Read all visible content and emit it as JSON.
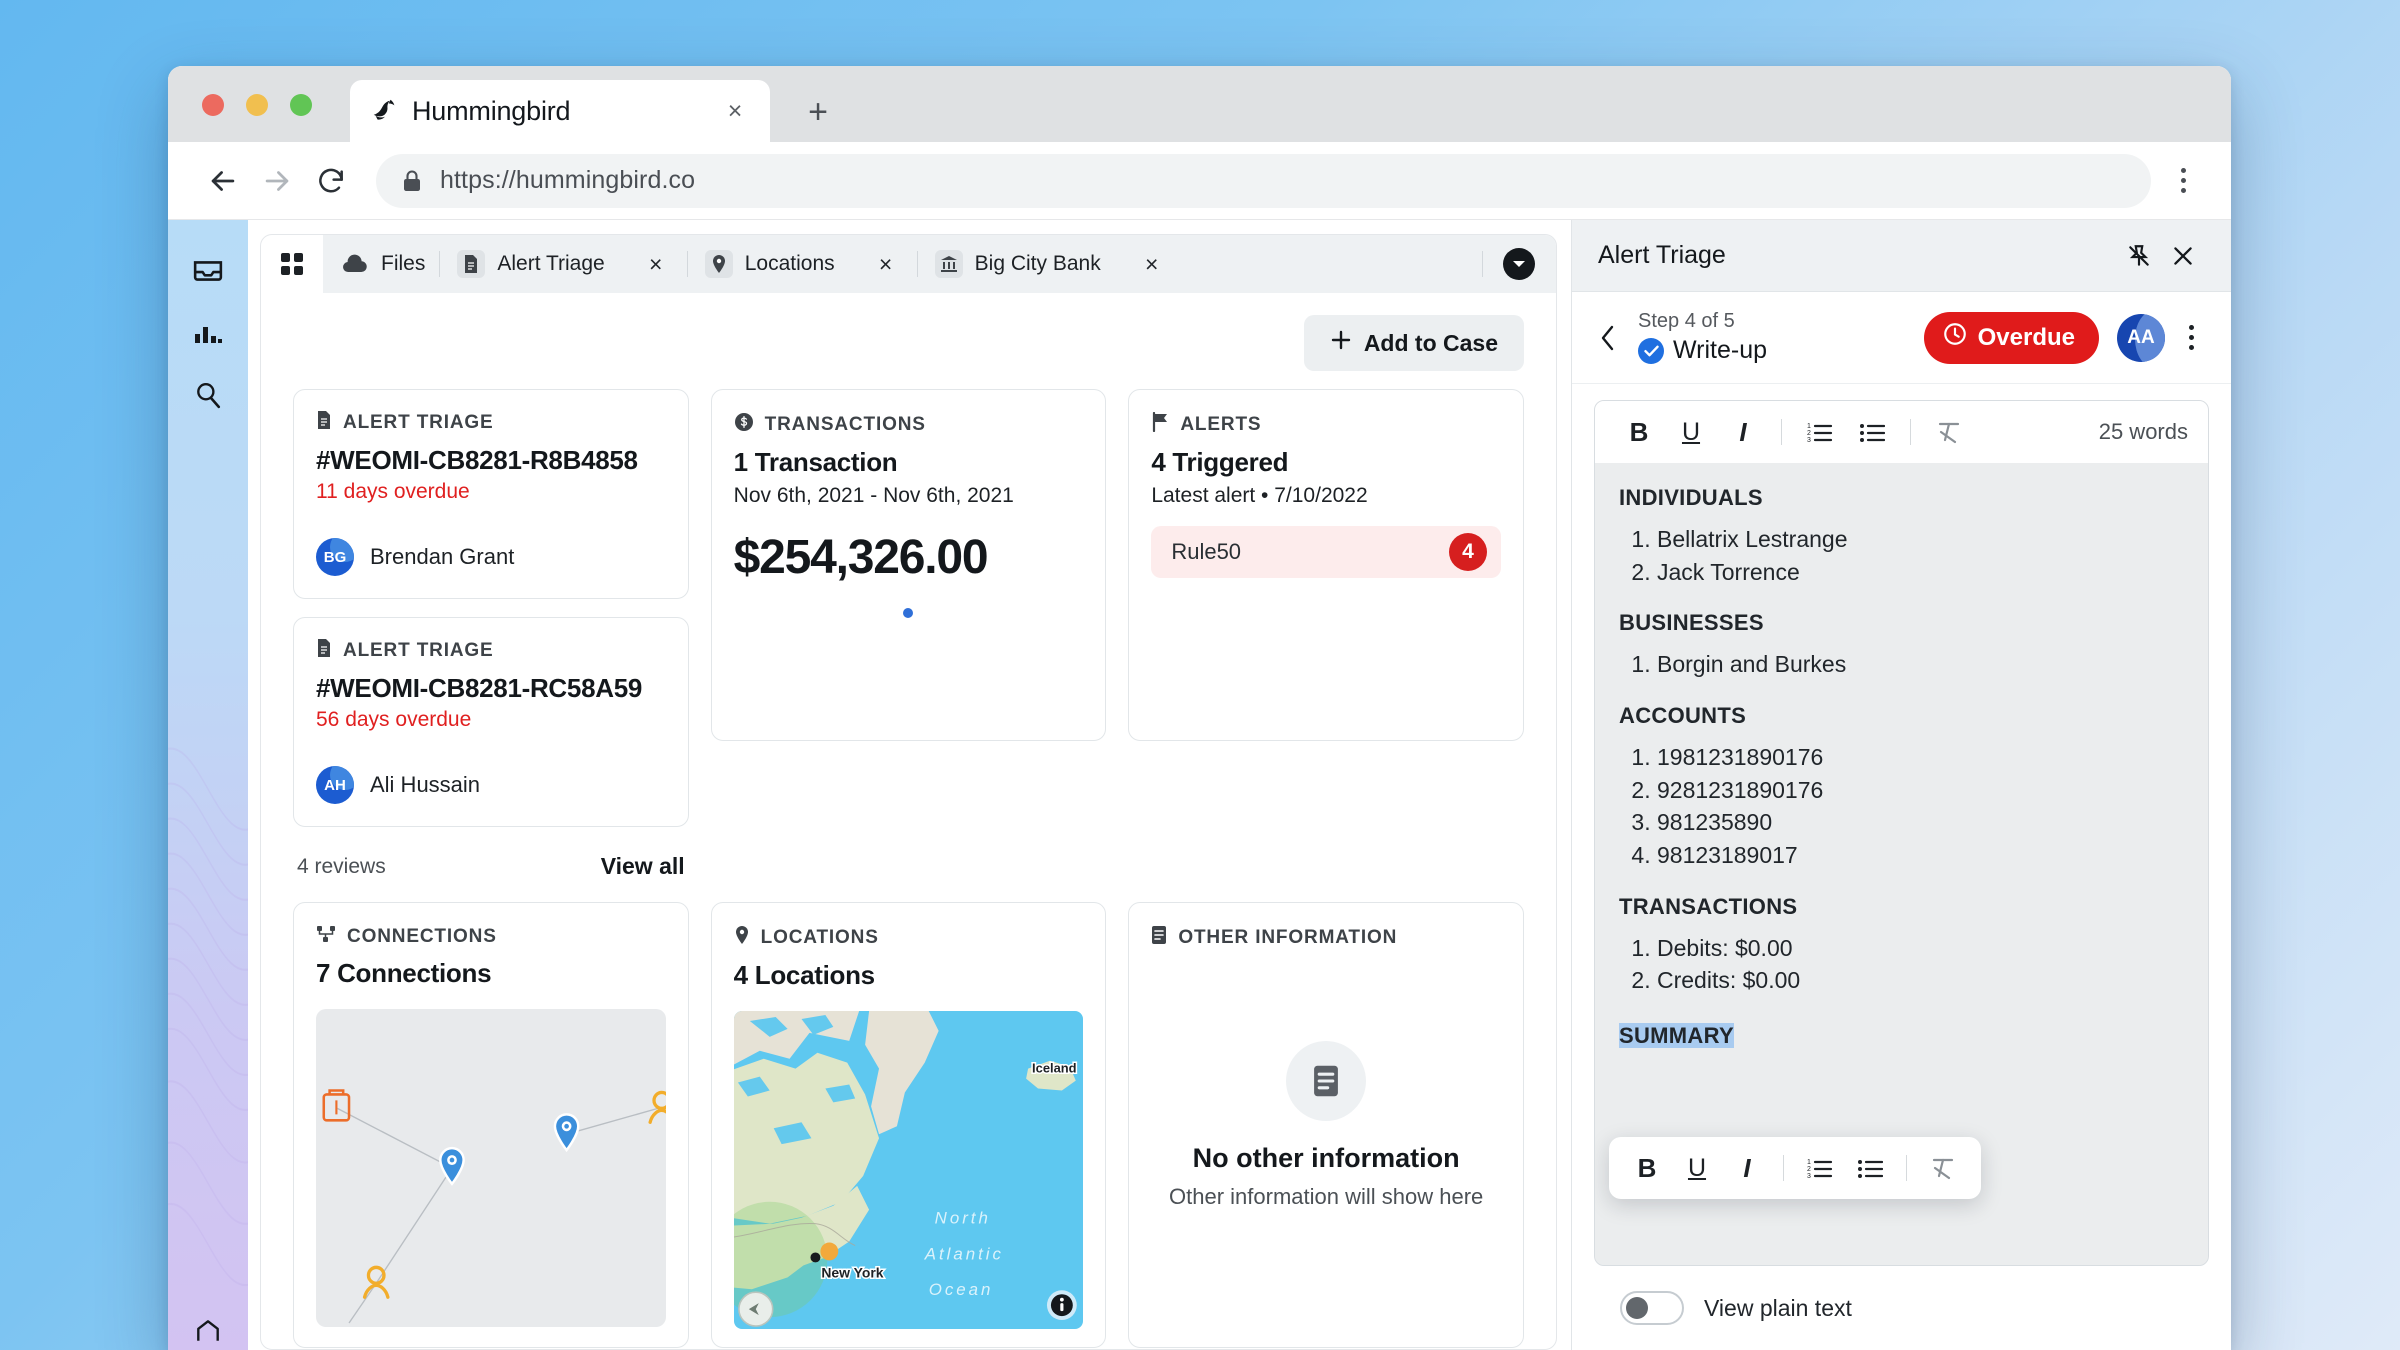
{
  "browser": {
    "tab_title": "Hummingbird",
    "tab_favicon": "hummingbird-logo-icon",
    "url": "https://hummingbird.co",
    "new_tab_label": "+",
    "close_tab_label": "×"
  },
  "rail": {
    "items": [
      {
        "name": "inbox-icon"
      },
      {
        "name": "analytics-icon"
      },
      {
        "name": "search-icon"
      }
    ]
  },
  "app_tabs": {
    "grid_icon": "grid-icon",
    "more_icon": "chevron-down-icon",
    "items": [
      {
        "label": "Files",
        "icon": "cloud-icon",
        "closable": false,
        "chip": false
      },
      {
        "label": "Alert Triage",
        "icon": "document-icon",
        "closable": true,
        "chip": true
      },
      {
        "label": "Locations",
        "icon": "map-pin-icon",
        "closable": true,
        "chip": true
      },
      {
        "label": "Big City Bank",
        "icon": "bank-icon",
        "closable": true,
        "chip": true
      }
    ],
    "close_label": "×"
  },
  "toolbar": {
    "add_to_case": "Add to Case",
    "add_icon": "plus-icon"
  },
  "cards": {
    "alert_triage": [
      {
        "kicker": "ALERT TRIAGE",
        "icon": "document-icon",
        "id": "#WEOMI-CB8281-R8B4858",
        "overdue": "11 days overdue",
        "assignee": "Brendan Grant",
        "initials": "BG"
      },
      {
        "kicker": "ALERT TRIAGE",
        "icon": "document-icon",
        "id": "#WEOMI-CB8281-RC58A59",
        "overdue": "56 days overdue",
        "assignee": "Ali Hussain",
        "initials": "AH"
      }
    ],
    "reviews": {
      "count_label": "4 reviews",
      "view_all": "View all"
    },
    "transactions": {
      "kicker": "TRANSACTIONS",
      "icon": "dollar-circle-icon",
      "title": "1 Transaction",
      "date_range": "Nov 6th, 2021 - Nov 6th, 2021",
      "amount": "$254,326.00"
    },
    "alerts": {
      "kicker": "ALERTS",
      "icon": "flag-icon",
      "title": "4 Triggered",
      "subtitle": "Latest alert  •  7/10/2022",
      "rule_name": "Rule50",
      "rule_count": "4"
    },
    "connections": {
      "kicker": "CONNECTIONS",
      "icon": "network-icon",
      "title": "7 Connections"
    },
    "locations": {
      "kicker": "LOCATIONS",
      "icon": "map-pin-icon",
      "title": "4 Locations",
      "map_labels": [
        "Iceland",
        "New York",
        "North",
        "Atlantic",
        "Ocean"
      ],
      "map_info_icon": "info-icon",
      "map_compass_icon": "compass-icon"
    },
    "other_information": {
      "kicker": "OTHER INFORMATION",
      "icon": "notes-icon",
      "empty_icon": "notes-icon",
      "empty_title": "No other information",
      "empty_subtitle": "Other information will show here"
    }
  },
  "right_panel": {
    "title": "Alert Triage",
    "pin_icon": "unpin-icon",
    "close_icon": "close-icon",
    "back_icon": "chevron-left-icon",
    "step_counter": "Step 4 of 5",
    "step_name": "Write-up",
    "step_check_icon": "check-circle-icon",
    "status_label": "Overdue",
    "status_icon": "clock-icon",
    "status_color": "#e01b1b",
    "avatar_initials": "AA",
    "menu_icon": "kebab-menu-icon",
    "editor": {
      "word_count": "25 words",
      "toolbar": [
        {
          "name": "bold-icon",
          "label": "B"
        },
        {
          "name": "underline-icon",
          "label": "U"
        },
        {
          "name": "italic-icon",
          "label": "I"
        },
        {
          "name": "ordered-list-icon",
          "label": ""
        },
        {
          "name": "bullet-list-icon",
          "label": ""
        },
        {
          "name": "clear-formatting-icon",
          "label": ""
        }
      ],
      "sections": [
        {
          "heading": "INDIVIDUALS",
          "items": [
            "Bellatrix Lestrange",
            "Jack Torrence"
          ]
        },
        {
          "heading": "BUSINESSES",
          "items": [
            "Borgin and Burkes"
          ]
        },
        {
          "heading": "ACCOUNTS",
          "items": [
            "1981231890176",
            "9281231890176",
            "981235890",
            "98123189017"
          ]
        },
        {
          "heading": "TRANSACTIONS",
          "items": [
            "Debits: $0.00",
            "Credits: $0.00"
          ]
        }
      ],
      "selected_text": "SUMMARY"
    },
    "plain_text_toggle": {
      "label": "View plain text",
      "on": false
    }
  }
}
